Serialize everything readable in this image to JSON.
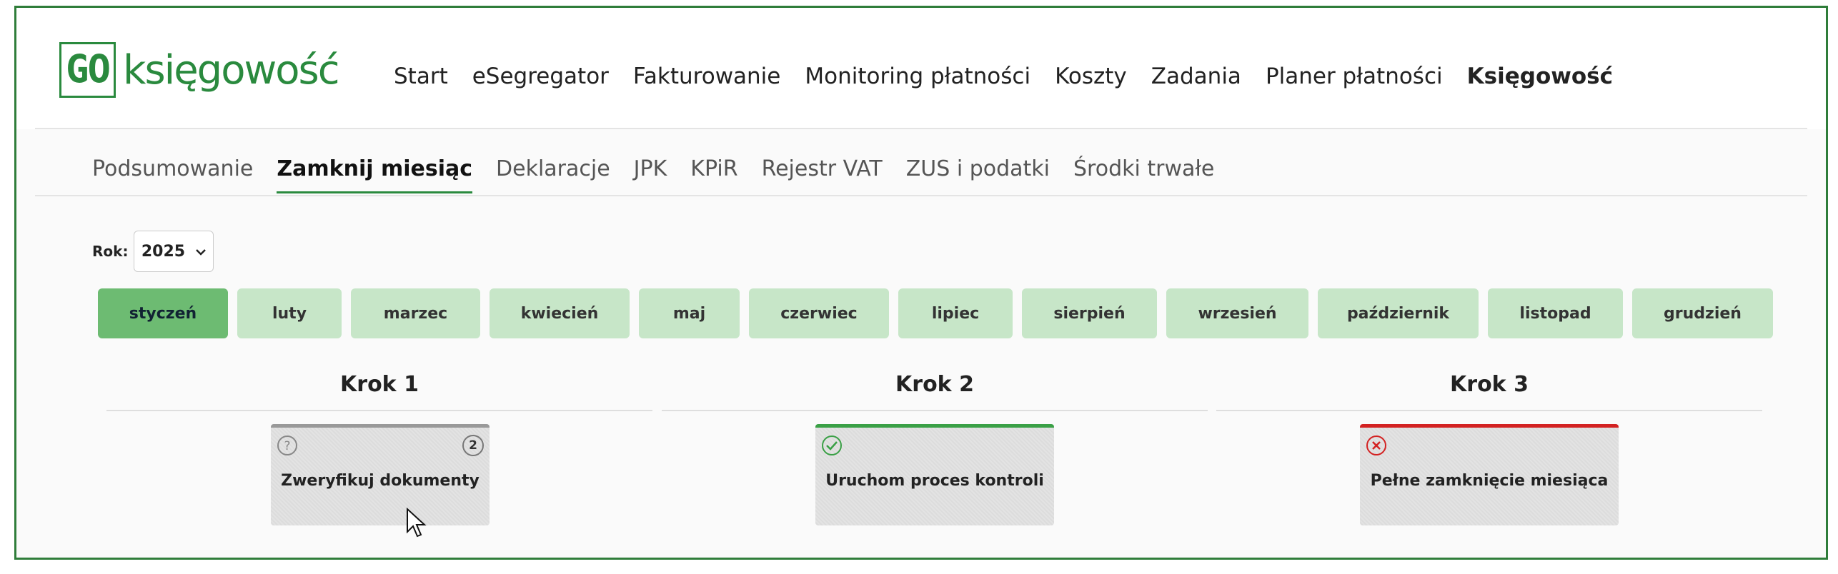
{
  "app": {
    "logo_go": "GO",
    "logo_text": "księgowość",
    "brand_color": "#2a8a3e"
  },
  "topnav": {
    "items": [
      {
        "label": "Start"
      },
      {
        "label": "eSegregator"
      },
      {
        "label": "Fakturowanie"
      },
      {
        "label": "Monitoring płatności"
      },
      {
        "label": "Koszty"
      },
      {
        "label": "Zadania"
      },
      {
        "label": "Planer płatności"
      },
      {
        "label": "Księgowość",
        "active": true
      }
    ]
  },
  "subnav": {
    "items": [
      {
        "label": "Podsumowanie"
      },
      {
        "label": "Zamknij miesiąc",
        "active": true
      },
      {
        "label": "Deklaracje"
      },
      {
        "label": "JPK"
      },
      {
        "label": "KPiR"
      },
      {
        "label": "Rejestr VAT"
      },
      {
        "label": "ZUS i podatki"
      },
      {
        "label": "Środki trwałe"
      }
    ]
  },
  "year": {
    "label": "Rok:",
    "value": "2025",
    "chevron_icon": "chevron-down-icon"
  },
  "months": {
    "items": [
      {
        "label": "styczeń",
        "active": true
      },
      {
        "label": "luty"
      },
      {
        "label": "marzec"
      },
      {
        "label": "kwiecień"
      },
      {
        "label": "maj"
      },
      {
        "label": "czerwiec"
      },
      {
        "label": "lipiec"
      },
      {
        "label": "sierpień"
      },
      {
        "label": "wrzesień"
      },
      {
        "label": "październik"
      },
      {
        "label": "listopad"
      },
      {
        "label": "grudzień"
      }
    ]
  },
  "steps": [
    {
      "title": "Krok 1",
      "card_label": "Zweryfikuj dokumenty",
      "status_icon": "question-icon",
      "badge": "2",
      "status": "neutral"
    },
    {
      "title": "Krok 2",
      "card_label": "Uruchom proces kontroli",
      "status_icon": "check-circle-icon",
      "status": "done"
    },
    {
      "title": "Krok 3",
      "card_label": "Pełne zamknięcie miesiąca",
      "status_icon": "error-circle-icon",
      "status": "error"
    }
  ],
  "colors": {
    "month_active": "#6dbb72",
    "month_inactive": "#c7e6c8",
    "status_done": "#3aa046",
    "status_error": "#d32222"
  }
}
